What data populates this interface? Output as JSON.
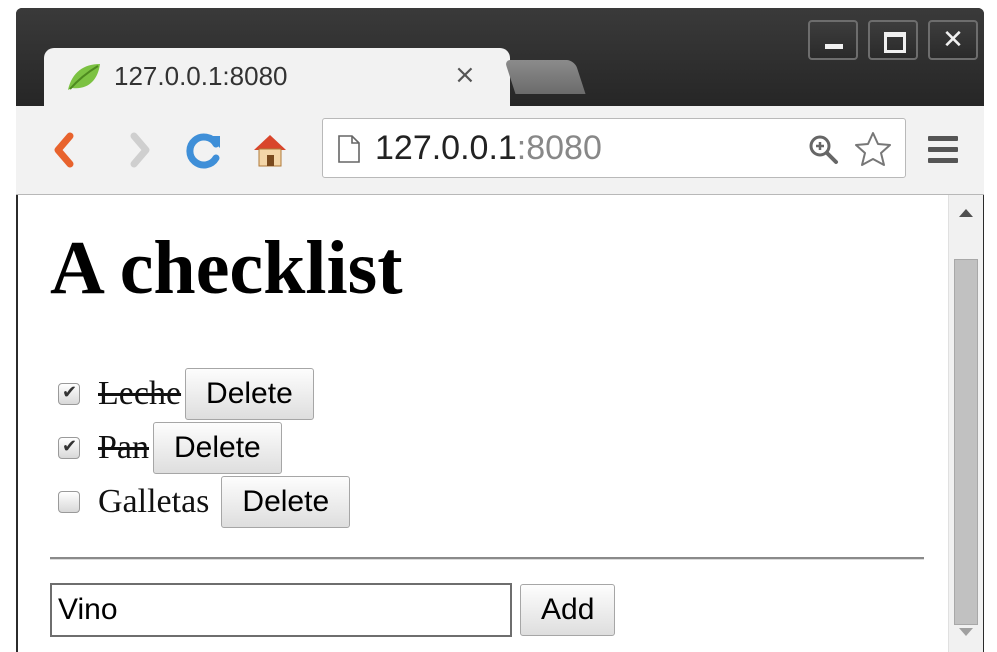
{
  "window": {
    "controls": {
      "minimize": "",
      "maximize": "",
      "close": "✕"
    }
  },
  "tab": {
    "title": "127.0.0.1:8080",
    "close": "×"
  },
  "toolbar": {
    "url_host": "127.0.0.1",
    "url_port": ":8080"
  },
  "page": {
    "title": "A checklist",
    "items": [
      {
        "label": "Leche",
        "checked": true,
        "delete_label": "Delete"
      },
      {
        "label": "Pan",
        "checked": true,
        "delete_label": "Delete"
      },
      {
        "label": "Galletas",
        "checked": false,
        "delete_label": "Delete"
      }
    ],
    "add_input_value": "Vino",
    "add_button_label": "Add"
  }
}
